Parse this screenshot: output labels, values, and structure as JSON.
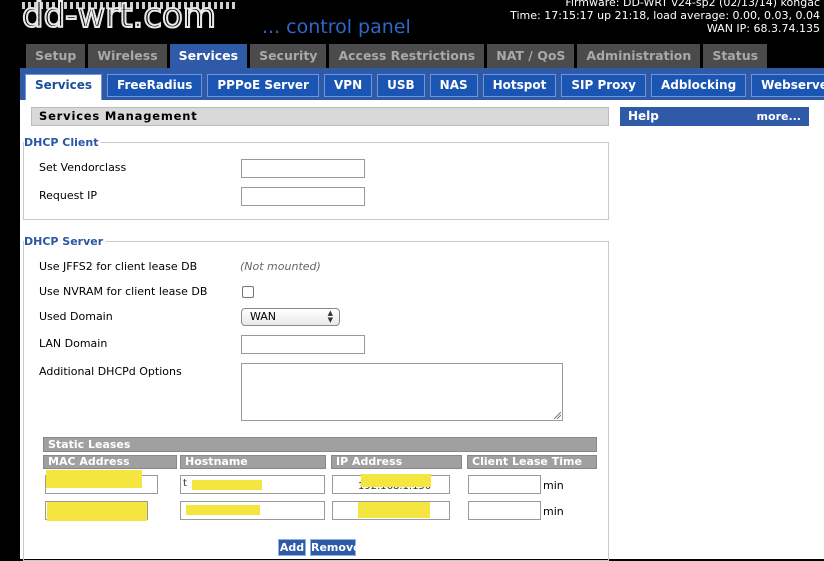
{
  "header": {
    "logo_text": "dd-wrt.com",
    "tagline": "... control panel",
    "firmware": "Firmware: DD-WRT v24-sp2 (02/13/14) kongac",
    "time": "Time: 17:15:17 up 21:18, load average: 0.00, 0.03, 0.04",
    "wan_ip": "WAN IP: 68.3.74.135"
  },
  "main_tabs": [
    {
      "label": "Setup"
    },
    {
      "label": "Wireless"
    },
    {
      "label": "Services"
    },
    {
      "label": "Security"
    },
    {
      "label": "Access Restrictions"
    },
    {
      "label": "NAT / QoS"
    },
    {
      "label": "Administration"
    },
    {
      "label": "Status"
    }
  ],
  "sub_tabs": [
    {
      "label": "Services"
    },
    {
      "label": "FreeRadius"
    },
    {
      "label": "PPPoE Server"
    },
    {
      "label": "VPN"
    },
    {
      "label": "USB"
    },
    {
      "label": "NAS"
    },
    {
      "label": "Hotspot"
    },
    {
      "label": "SIP Proxy"
    },
    {
      "label": "Adblocking"
    },
    {
      "label": "Webserver"
    }
  ],
  "section_title": "Services Management",
  "help": {
    "title": "Help",
    "more": "more..."
  },
  "dhcp_client": {
    "legend": "DHCP Client",
    "vendorclass_label": "Set Vendorclass",
    "vendorclass_value": "",
    "request_ip_label": "Request IP",
    "request_ip_value": ""
  },
  "dhcp_server": {
    "legend": "DHCP Server",
    "jffs2_label": "Use JFFS2 for client lease DB",
    "jffs2_status": "(Not mounted)",
    "nvram_label": "Use NVRAM for client lease DB",
    "used_domain_label": "Used Domain",
    "used_domain_value": "WAN",
    "lan_domain_label": "LAN Domain",
    "lan_domain_value": "",
    "dhcpd_options_label": "Additional DHCPd Options"
  },
  "static_leases": {
    "title": "Static Leases",
    "columns": [
      "MAC Address",
      "Hostname",
      "IP Address",
      "Client Lease Time"
    ],
    "rows": [
      {
        "mac": "",
        "hostname": "t",
        "ip": "192.168.1.150",
        "lease": ""
      },
      {
        "mac": "",
        "hostname": "",
        "ip": "",
        "lease": ""
      }
    ],
    "lease_unit": "min",
    "add_label": "Add",
    "remove_label": "Remove"
  },
  "colors": {
    "accent": "#2f5aa8",
    "redaction": "#f5e53f"
  }
}
